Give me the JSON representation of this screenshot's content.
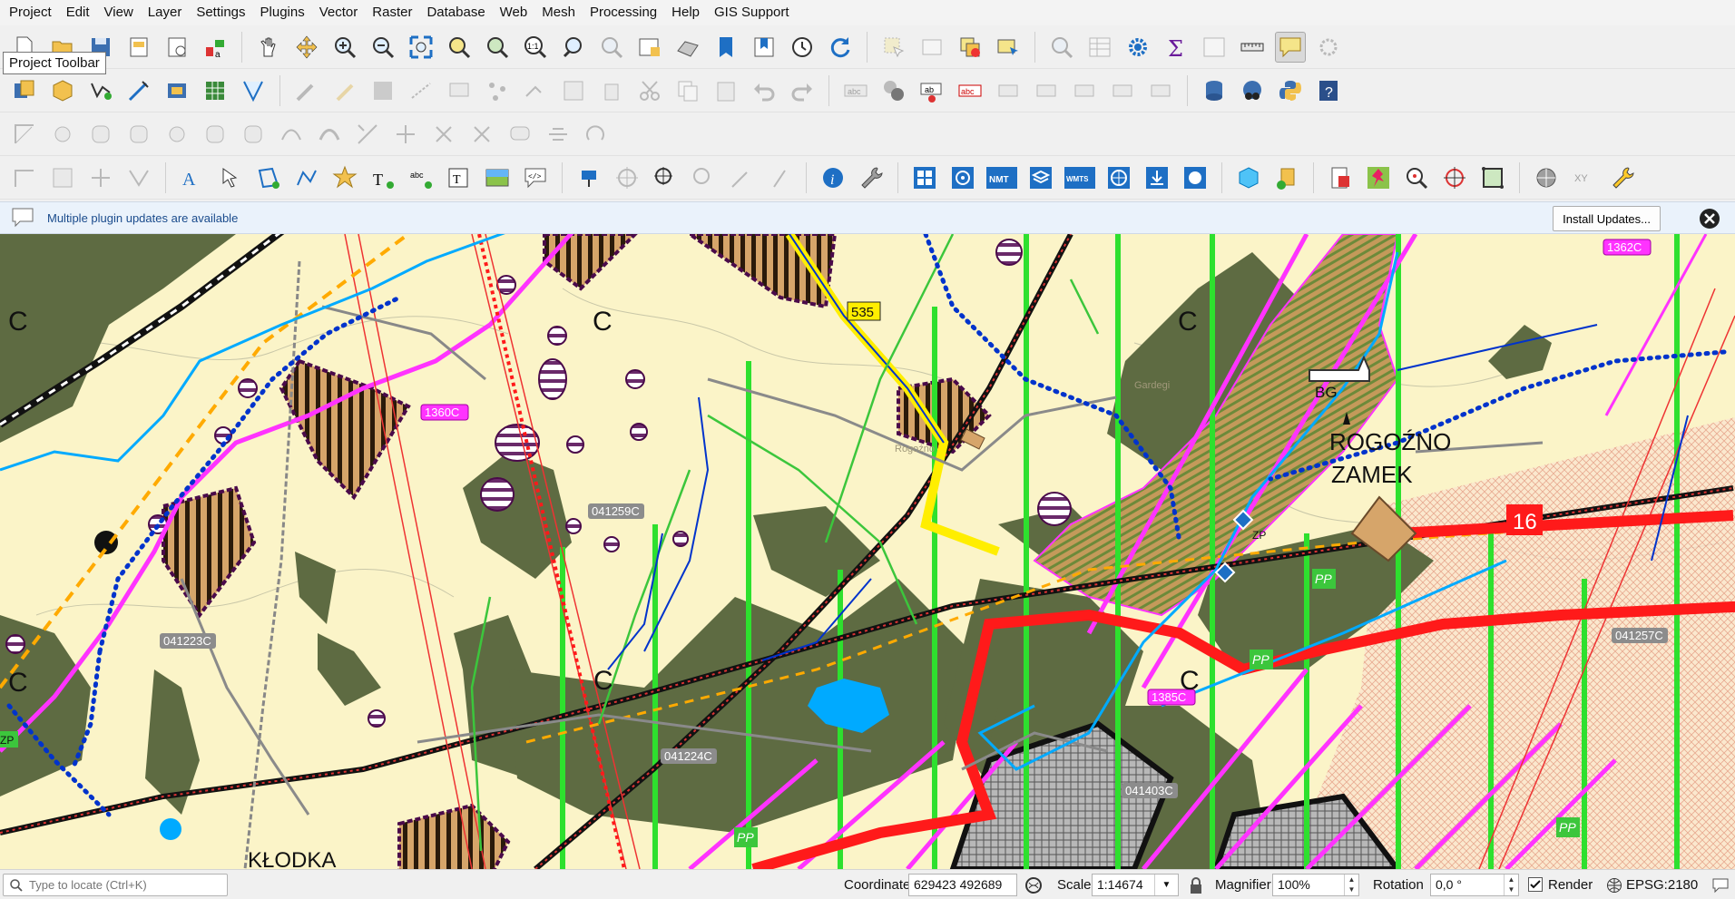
{
  "menu": [
    "Project",
    "Edit",
    "View",
    "Layer",
    "Settings",
    "Plugins",
    "Vector",
    "Raster",
    "Database",
    "Web",
    "Mesh",
    "Processing",
    "Help",
    "GIS Support"
  ],
  "tooltip": "Project Toolbar",
  "toolbar_labels": {
    "nmt": "NMT",
    "wmts": "WMTS",
    "ab": "ab",
    "abc": "abc",
    "xy": "XY"
  },
  "message_bar": {
    "text": "Multiple plugin updates are available",
    "install_button": "Install Updates..."
  },
  "map_labels": {
    "road_535": "535",
    "road_16": "16",
    "c1": "C",
    "c2": "C",
    "c3": "C",
    "c4": "C",
    "c5": "C",
    "c6": "C",
    "bg": "BG",
    "zp1": "ZP",
    "zp2": "ZP",
    "town1": "ROGOŹNO",
    "town2": "ZAMEK",
    "town3": "KŁODKA",
    "pp1": "PP",
    "pp2": "PP",
    "pp3": "PP",
    "pp4": "PP",
    "rd_1360": "1360C",
    "rd_1362": "1362C",
    "rd_1385": "1385C",
    "rd_041259": "041259C",
    "rd_041223": "041223C",
    "rd_041224": "041224C",
    "rd_041257": "041257C",
    "rd_041403": "041403C",
    "faint1": "Rogoźno",
    "faint2": "Gardegi"
  },
  "statusbar": {
    "locator_placeholder": "Type to locate (Ctrl+K)",
    "coordinate_label": "Coordinate",
    "coordinate_value": "629423  492689",
    "scale_label": "Scale",
    "scale_value": "1:14674",
    "magnifier_label": "Magnifier",
    "magnifier_value": "100%",
    "rotation_label": "Rotation",
    "rotation_value": "0,0 °",
    "render_label": "Render",
    "render_checked": true,
    "crs": "EPSG:2180"
  },
  "colors": {
    "map_background": "#fbf4c8",
    "forest": "#5e6b42",
    "railway": "#1a1a1a",
    "road_red": "#ff1a1a",
    "magenta": "#ff33ff",
    "bright_green": "#2ee02e",
    "river_blue": "#00aaff",
    "route_blue": "#0033cc",
    "road_yellow": "#ffee00",
    "dashed_orange": "#ffaa00",
    "qgis_blue": "#1e6fc4"
  }
}
